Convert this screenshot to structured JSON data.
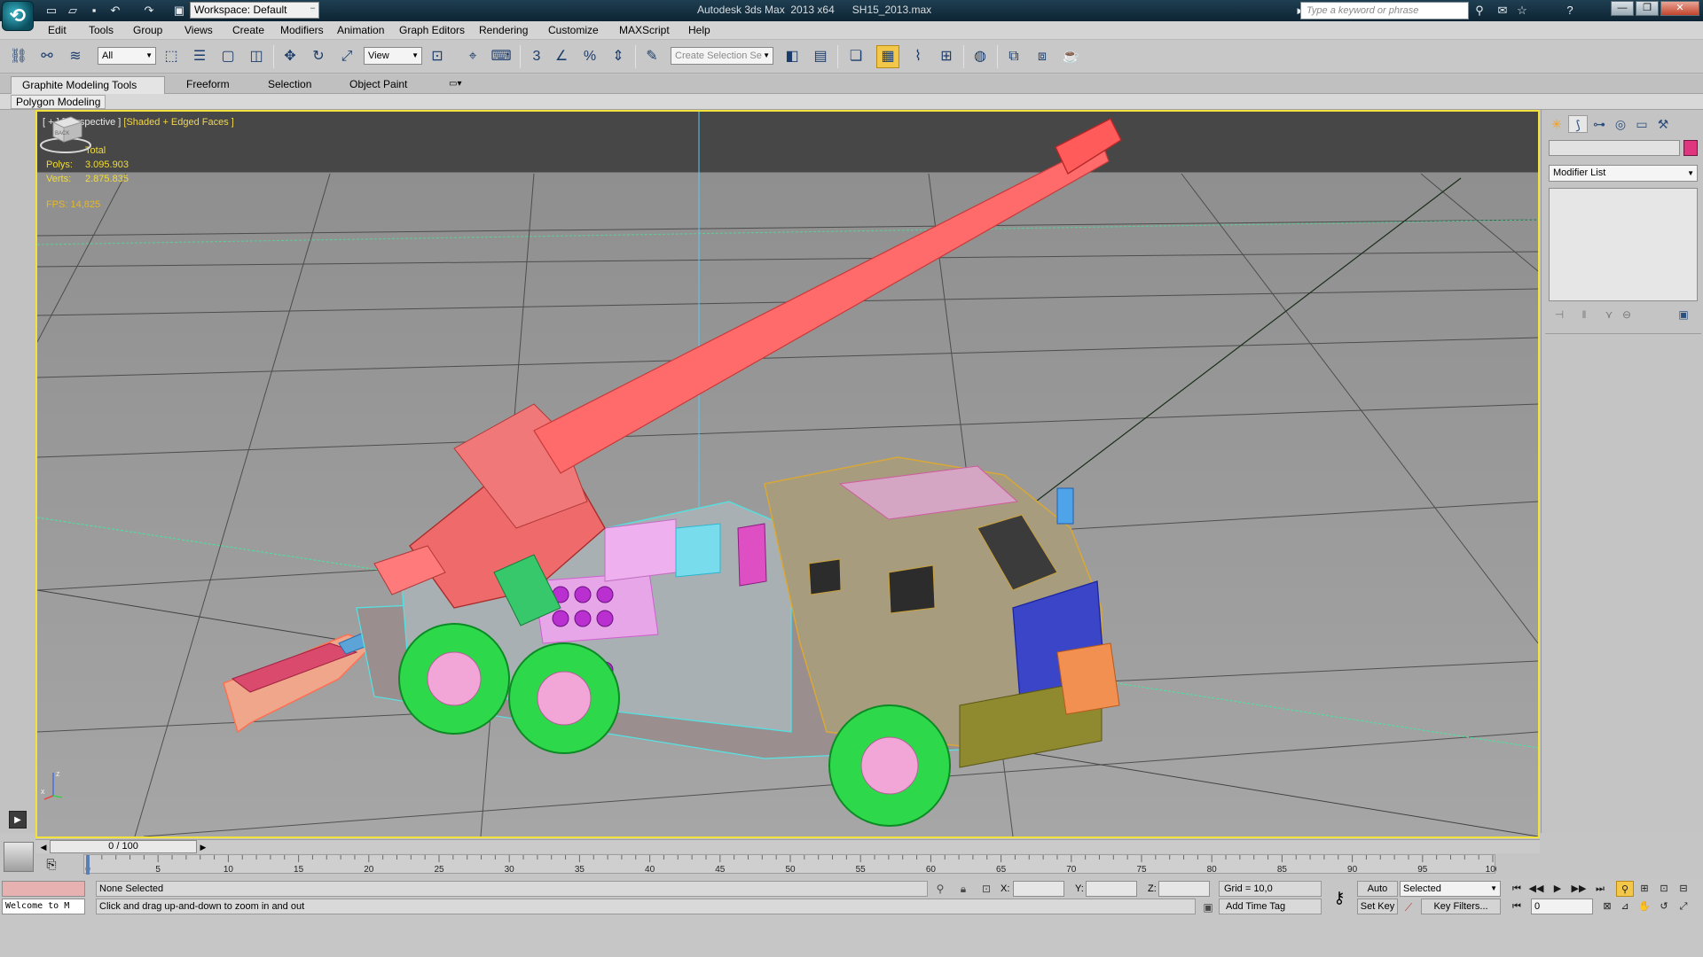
{
  "title_bar": {
    "workspace_label": "Workspace: Default",
    "title": "Autodesk 3ds Max  2013 x64      SH15_2013.max",
    "search_placeholder": "Type a keyword or phrase"
  },
  "menu": {
    "items": [
      "Edit",
      "Tools",
      "Group",
      "Views",
      "Create",
      "Modifiers",
      "Animation",
      "Graph Editors",
      "Rendering",
      "Customize",
      "MAXScript",
      "Help"
    ]
  },
  "toolbar": {
    "selection_filter": "All",
    "reference_coord": "View",
    "selection_set_placeholder": "Create Selection Se",
    "snap_label": "3"
  },
  "ribbon": {
    "tabs": [
      "Graphite Modeling Tools",
      "Freeform",
      "Selection",
      "Object Paint"
    ],
    "panel_label": "Polygon Modeling"
  },
  "viewport": {
    "label_prefix": "[ + ] [Perspective ] ",
    "label_shading": "[Shaded + Edged Faces ]",
    "stats_header": "Total",
    "polys_label": "Polys:",
    "polys_value": "3.095.903",
    "verts_label": "Verts:",
    "verts_value": "2.875.835",
    "fps_label": "FPS:",
    "fps_value": "14,825",
    "viewcube_face": "BACK",
    "axis_z": "z",
    "axis_x": "x"
  },
  "command_panel": {
    "modifier_list": "Modifier List",
    "object_color": "#e0357f"
  },
  "time_slider": {
    "frame_display": "0 / 100",
    "ticks": [
      "0",
      "5",
      "10",
      "15",
      "20",
      "25",
      "30",
      "35",
      "40",
      "45",
      "50",
      "55",
      "60",
      "65",
      "70",
      "75",
      "80",
      "85",
      "90",
      "95",
      "100"
    ]
  },
  "status": {
    "maxscript_text": "Welcome to M",
    "selection_text": "None Selected",
    "prompt_text": "Click and drag up-and-down to zoom in and out",
    "x_label": "X:",
    "y_label": "Y:",
    "z_label": "Z:",
    "grid_text": "Grid = 10,0",
    "add_time_tag": "Add Time Tag",
    "auto_key": "Auto Key",
    "set_key": "Set Key",
    "key_mode_selected": "Selected",
    "key_filters": "Key Filters...",
    "current_frame": "0"
  },
  "colors": {
    "viewport_border": "#f2e23b",
    "barrel": "#ff6a6a",
    "cab": "#c9a13b",
    "wheels": "#2ed84b",
    "hubs": "#f2a6d8",
    "cyan_parts": "#4fe3e3",
    "magenta_parts": "#c03ad8",
    "stats_text": "#f1dc3a"
  }
}
